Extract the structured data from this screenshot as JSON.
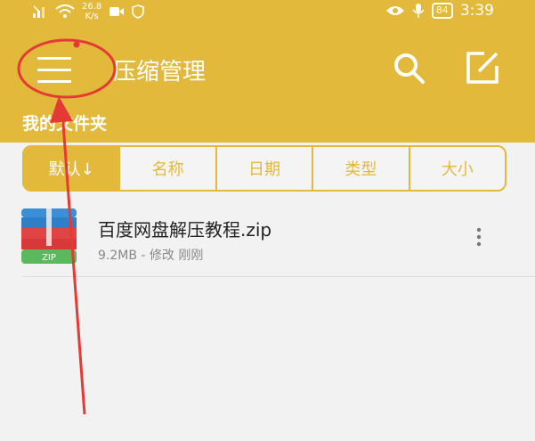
{
  "status_bar": {
    "signal": "signal-icon",
    "wifi": "wifi-icon",
    "speed_value": "26.8",
    "speed_unit": "K/s",
    "time": "3:39",
    "battery": "84"
  },
  "appbar": {
    "title": "压缩管理",
    "menu_icon": "menu-icon",
    "search_icon": "search-icon",
    "edit_icon": "edit-icon"
  },
  "folder_label": "我的文件夹",
  "sort_tabs": [
    {
      "label": "默认↓",
      "active": true
    },
    {
      "label": "名称",
      "active": false
    },
    {
      "label": "日期",
      "active": false
    },
    {
      "label": "类型",
      "active": false
    },
    {
      "label": "大小",
      "active": false
    }
  ],
  "files": [
    {
      "name": "百度网盘解压教程.zip",
      "meta": "9.2MB - 修改 刚刚",
      "icon_text": "ZIP"
    }
  ],
  "colors": {
    "accent": "#e2b93b",
    "annotation": "#e53935"
  }
}
